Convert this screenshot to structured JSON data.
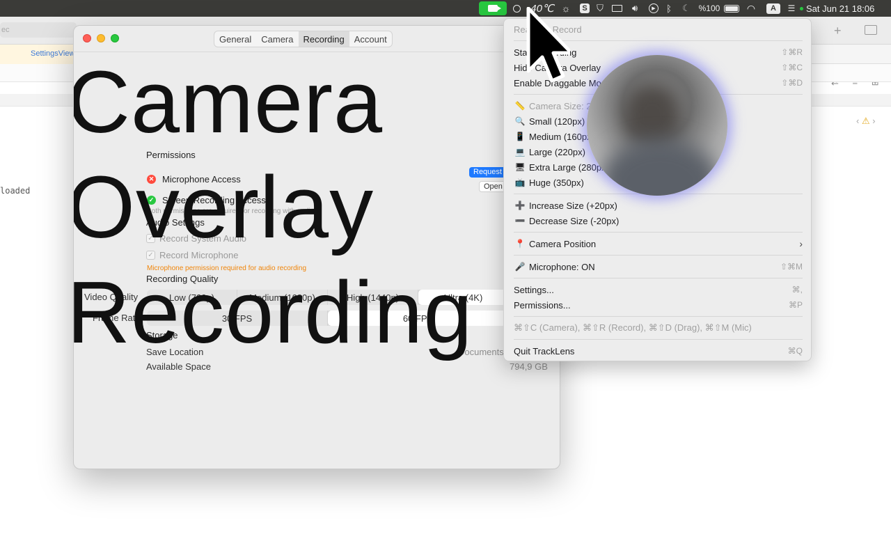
{
  "menubar": {
    "temperature": "40℃",
    "battery_pct": "%100",
    "input_source": "A",
    "datetime": "Sat Jun 21  18:06"
  },
  "background": {
    "address_text": "ec",
    "tab_label": "SettingsView",
    "code_text": "loaded"
  },
  "window": {
    "tabs": [
      "General",
      "Camera",
      "Recording",
      "Account"
    ],
    "overlay_title": "Camera Overlay Recording",
    "permissions": {
      "heading": "Permissions",
      "microphone": "Microphone Access",
      "screen": "Screen Recording Access",
      "note": "Both permissions are required for recording with audio",
      "request_button": "Request",
      "open_button": "Open"
    },
    "audio": {
      "heading": "Audio Settings",
      "system_audio": "Record System Audio",
      "microphone": "Record Microphone",
      "warning": "Microphone permission required for audio recording"
    },
    "quality": {
      "heading": "Recording Quality",
      "video_label": "Video Quality",
      "video_options": [
        "Low (720p)",
        "Medium (1080p)",
        "High (1440p)",
        "Ultra (4K)"
      ],
      "video_selected": "Ultra (4K)",
      "frame_label": "Frame Rate",
      "frame_options": [
        "30 FPS",
        "60 FPS"
      ],
      "frame_selected": "60 FPS"
    },
    "storage": {
      "heading": "Storage",
      "save_label": "Save Location",
      "save_value": "Documents",
      "space_label": "Available Space",
      "space_value": "794,9 GB"
    }
  },
  "menu": {
    "header": "Ready to Record",
    "start": {
      "label": "Start Recording",
      "shortcut": "⇧⌘R"
    },
    "hide_overlay": {
      "label": "Hide Camera Overlay",
      "shortcut": "⇧⌘C"
    },
    "drag_mode": {
      "label": "Enable Draggable Mode",
      "shortcut": "⇧⌘D"
    },
    "size_header": "Camera Size: 220px",
    "sizes": [
      "Small (120px)",
      "Medium (160px)",
      "Large (220px)",
      "Extra Large (280px)",
      "Huge (350px)"
    ],
    "increase": "Increase Size (+20px)",
    "decrease": "Decrease Size (-20px)",
    "position": "Camera Position",
    "microphone": {
      "label": "Microphone: ON",
      "shortcut": "⇧⌘M"
    },
    "settings": {
      "label": "Settings...",
      "shortcut": "⌘,"
    },
    "permissions": {
      "label": "Permissions...",
      "shortcut": "⌘P"
    },
    "shortcuts_hint": "⌘⇧C (Camera), ⌘⇧R (Record), ⌘⇧D (Drag), ⌘⇧M (Mic)",
    "quit": {
      "label": "Quit TrackLens",
      "shortcut": "⌘Q"
    }
  }
}
